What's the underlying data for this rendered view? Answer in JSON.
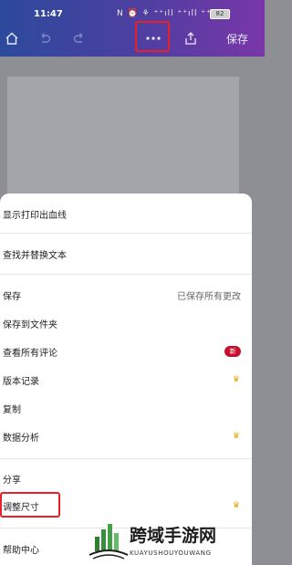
{
  "status": {
    "time": "11:47",
    "icons": "N ⏰ ⚘ ⁺⁺ıll ⁺⁺ıll ⁺⁺ıll ✦",
    "battery": "82"
  },
  "toolbar": {
    "save_label": "保存"
  },
  "menu": {
    "items": [
      {
        "label": "显示打印出血线"
      },
      {
        "label": "查找并替换文本"
      },
      {
        "label": "保存",
        "value": "已保存所有更改"
      },
      {
        "label": "保存到文件夹"
      },
      {
        "label": "查看所有评论",
        "badge": "新"
      },
      {
        "label": "版本记录",
        "crown": "♛"
      },
      {
        "label": "复制"
      },
      {
        "label": "数据分析",
        "crown": "♛"
      },
      {
        "label": "分享"
      },
      {
        "label": "调整尺寸",
        "crown": "♛"
      },
      {
        "label": "帮助中心"
      }
    ]
  },
  "watermark": {
    "title": "跨域手游网",
    "subtitle": "KUAYUSHOUYOUWANG"
  },
  "colors": {
    "highlight": "#e8202a",
    "badge": "#c8102e",
    "crown": "#e0a800"
  }
}
